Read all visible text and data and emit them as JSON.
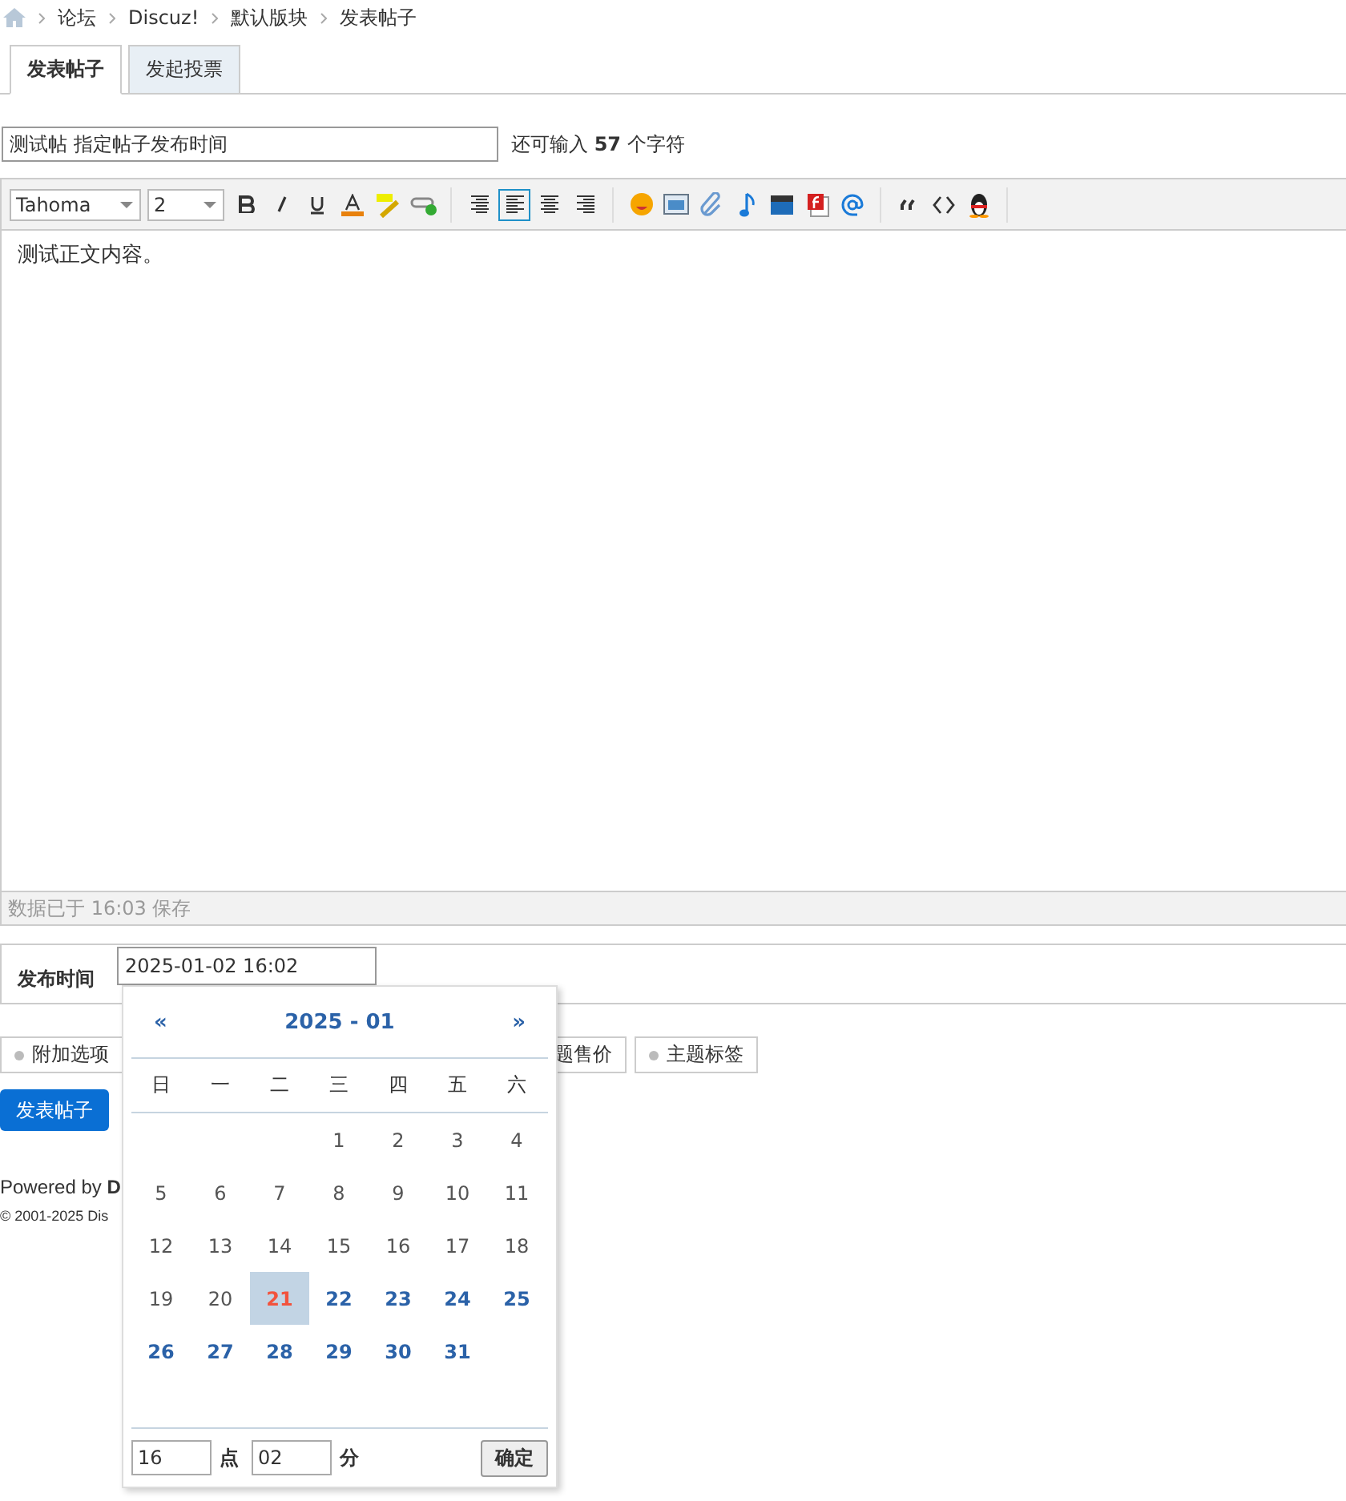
{
  "breadcrumb": [
    "论坛",
    "Discuz!",
    "默认版块",
    "发表帖子"
  ],
  "tabs": [
    {
      "label": "发表帖子",
      "selected": true
    },
    {
      "label": "发起投票",
      "selected": false
    }
  ],
  "subject": {
    "value": "测试帖 指定帖子发布时间",
    "counter": "还可输入 **57** 个字符"
  },
  "editor": {
    "font": "Tahoma",
    "size": "2",
    "align_buttons": [
      {
        "selected": false
      },
      {
        "selected": true
      },
      {
        "selected": false
      },
      {
        "selected": false
      }
    ],
    "body": "测试正文内容。",
    "status": "数据已于 16:03 保存"
  },
  "publish_time": {
    "label": "发布时间",
    "value": "2025-01-02 16:02"
  },
  "options": [
    "附加选项",
    "题售价",
    "主题标签"
  ],
  "submit": "发表帖子",
  "footer": {
    "powered": "Powered by **D**",
    "copyright": "© 2001-2025 Dis"
  },
  "calendar": {
    "prev": "«",
    "title": "2025 - 01",
    "next": "»",
    "weekdays": [
      "日",
      "一",
      "二",
      "三",
      "四",
      "五",
      "六"
    ],
    "weeks": [
      [
        {
          "day": "1",
          "kind": "past",
          "selected": false
        },
        {
          "day": "2",
          "kind": "past",
          "selected": false
        },
        {
          "day": "3",
          "kind": "past",
          "selected": false
        },
        {
          "day": "4",
          "kind": "past",
          "selected": false
        }
      ],
      [
        {
          "day": "5",
          "kind": "past",
          "selected": false
        },
        {
          "day": "6",
          "kind": "past",
          "selected": false
        },
        {
          "day": "7",
          "kind": "past",
          "selected": false
        },
        {
          "day": "8",
          "kind": "past",
          "selected": false
        },
        {
          "day": "9",
          "kind": "past",
          "selected": false
        },
        {
          "day": "10",
          "kind": "past",
          "selected": false
        },
        {
          "day": "11",
          "kind": "past",
          "selected": false
        }
      ],
      [
        {
          "day": "12",
          "kind": "past",
          "selected": false
        },
        {
          "day": "13",
          "kind": "past",
          "selected": false
        },
        {
          "day": "14",
          "kind": "past",
          "selected": false
        },
        {
          "day": "15",
          "kind": "past",
          "selected": false
        },
        {
          "day": "16",
          "kind": "past",
          "selected": false
        },
        {
          "day": "17",
          "kind": "past",
          "selected": false
        },
        {
          "day": "18",
          "kind": "past",
          "selected": false
        }
      ],
      [
        {
          "day": "19",
          "kind": "past",
          "selected": false
        },
        {
          "day": "20",
          "kind": "past",
          "selected": false
        },
        {
          "day": "21",
          "kind": "today",
          "selected": true
        },
        {
          "day": "22",
          "kind": "future",
          "selected": false
        },
        {
          "day": "23",
          "kind": "future",
          "selected": false
        },
        {
          "day": "24",
          "kind": "future",
          "selected": false
        },
        {
          "day": "25",
          "kind": "future",
          "selected": false
        }
      ],
      [
        {
          "day": "26",
          "kind": "future",
          "selected": false
        },
        {
          "day": "27",
          "kind": "future",
          "selected": false
        },
        {
          "day": "28",
          "kind": "future",
          "selected": false
        },
        {
          "day": "29",
          "kind": "future",
          "selected": false
        },
        {
          "day": "30",
          "kind": "future",
          "selected": false
        },
        {
          "day": "31",
          "kind": "future",
          "selected": false
        }
      ]
    ],
    "hour": "16",
    "hour_unit": "点",
    "minute": "02",
    "minute_unit": "分",
    "confirm": "确定"
  }
}
